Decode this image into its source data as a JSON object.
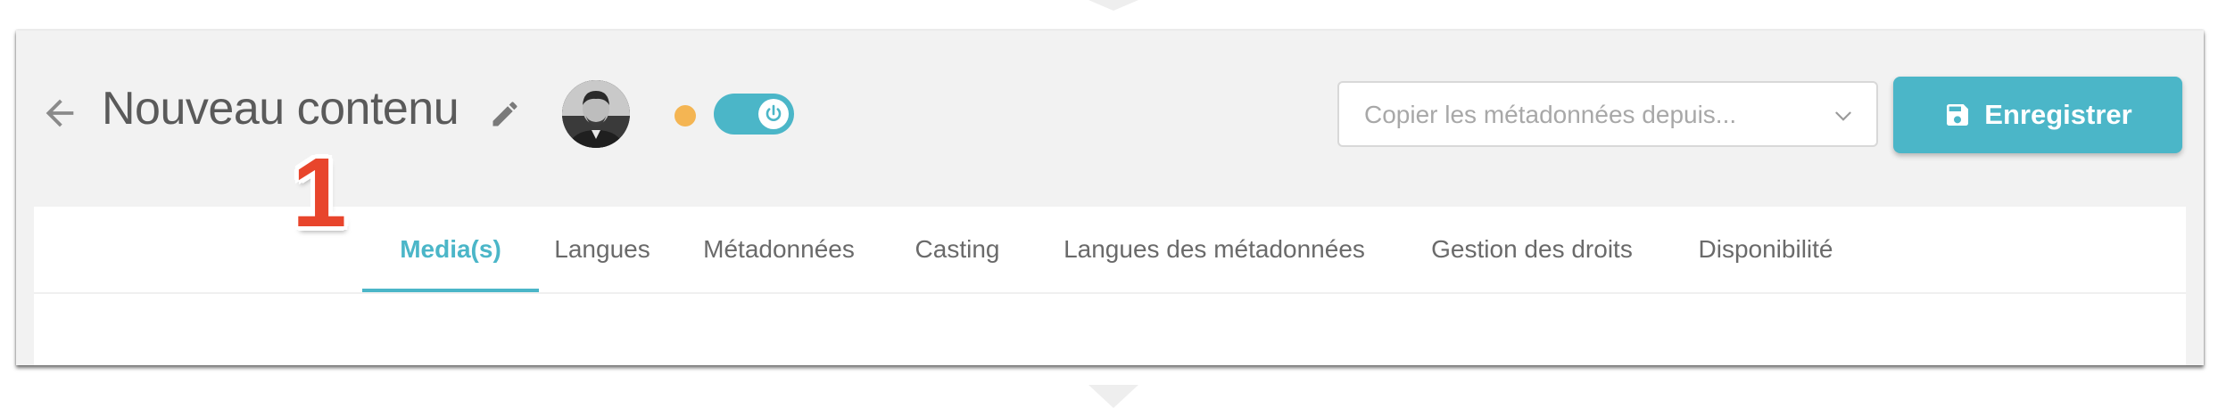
{
  "header": {
    "title": "Nouveau contenu",
    "status_color": "#f4b553",
    "toggle_state": "on",
    "copy_select": {
      "placeholder": "Copier les métadonnées depuis..."
    },
    "save_label": "Enregistrer"
  },
  "tabs": [
    {
      "label": "Media(s)",
      "active": true
    },
    {
      "label": "Langues",
      "active": false
    },
    {
      "label": "Métadonnées",
      "active": false
    },
    {
      "label": "Casting",
      "active": false
    },
    {
      "label": "Langues des métadonnées",
      "active": false
    },
    {
      "label": "Gestion des droits",
      "active": false
    },
    {
      "label": "Disponibilité",
      "active": false
    }
  ],
  "annotation": {
    "step": "1"
  },
  "colors": {
    "accent": "#4bb6c8",
    "annotation": "#e8452c",
    "background": "#f2f2f2"
  },
  "icons": [
    "arrow-left-icon",
    "pencil-icon",
    "power-icon",
    "chevron-down-icon",
    "floppy-disk-icon"
  ]
}
